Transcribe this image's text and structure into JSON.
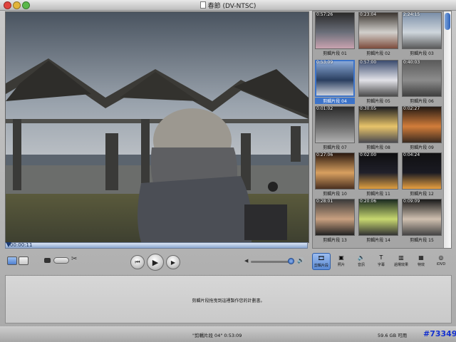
{
  "window": {
    "title": "春節 (DV-NTSC)"
  },
  "monitor": {
    "timecode": "00:00:11"
  },
  "clips": [
    {
      "label": "剪輯片段 01",
      "duration": "0:57:26"
    },
    {
      "label": "剪輯片段 02",
      "duration": "0:23:04"
    },
    {
      "label": "剪輯片段 03",
      "duration": "2:24:15"
    },
    {
      "label": "剪輯片段 04",
      "duration": "0:53:09",
      "selected": true
    },
    {
      "label": "剪輯片段 05",
      "duration": "0:57:00"
    },
    {
      "label": "剪輯片段 06",
      "duration": "0:40:03"
    },
    {
      "label": "剪輯片段 07",
      "duration": "0:01:02"
    },
    {
      "label": "剪輯片段 08",
      "duration": "0:30:05"
    },
    {
      "label": "剪輯片段 09",
      "duration": "0:02:27"
    },
    {
      "label": "剪輯片段 10",
      "duration": "0:27:06"
    },
    {
      "label": "剪輯片段 11",
      "duration": "0:02:00"
    },
    {
      "label": "剪輯片段 12",
      "duration": "0:04:24"
    },
    {
      "label": "剪輯片段 13",
      "duration": "0:28:01"
    },
    {
      "label": "剪輯片段 14",
      "duration": "0:20:06"
    },
    {
      "label": "剪輯片段 15",
      "duration": "0:09:09"
    }
  ],
  "panes": [
    {
      "label": "剪輯片段",
      "icon": "film-icon"
    },
    {
      "label": "照片",
      "icon": "photo-icon"
    },
    {
      "label": "音訊",
      "icon": "speaker-icon"
    },
    {
      "label": "字幕",
      "icon": "text-icon"
    },
    {
      "label": "過場效果",
      "icon": "transition-icon"
    },
    {
      "label": "特效",
      "icon": "effects-icon"
    },
    {
      "label": "iDVD",
      "icon": "idvd-icon"
    }
  ],
  "timeline": {
    "hint": "剪輯片段拖曳到這裡製作您的計劃書。"
  },
  "status": {
    "clip_info": "\"剪輯片段 04\"  0:53:09",
    "free_space": "59.6 GB 可用",
    "counter": "#73349"
  },
  "colors": {
    "selection": "#3c73c9"
  }
}
